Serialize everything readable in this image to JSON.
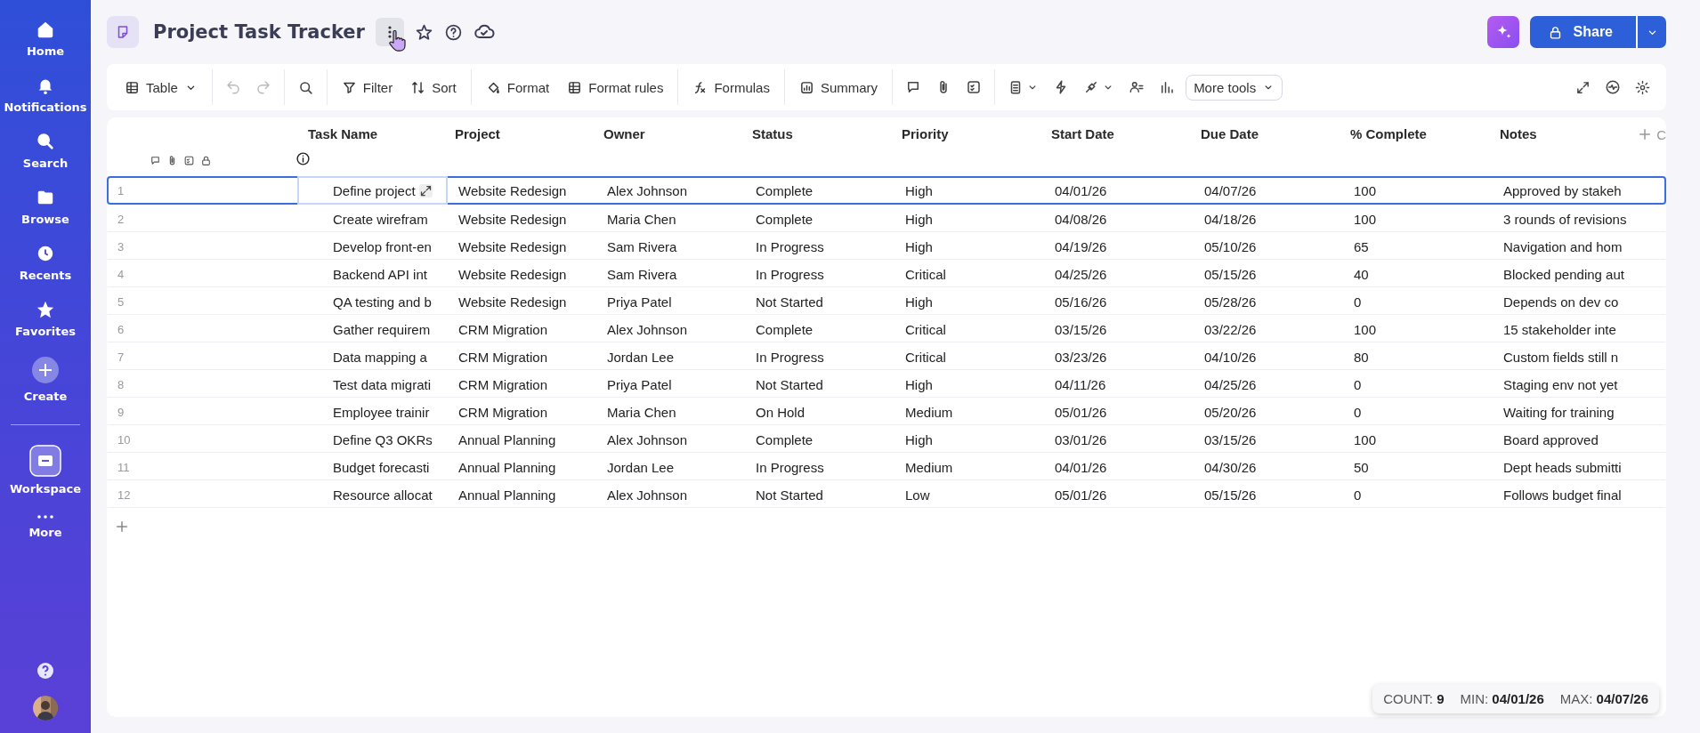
{
  "sidebar": {
    "items": [
      {
        "label": "Home"
      },
      {
        "label": "Notifications"
      },
      {
        "label": "Search"
      },
      {
        "label": "Browse"
      },
      {
        "label": "Recents"
      },
      {
        "label": "Favorites"
      },
      {
        "label": "Create"
      },
      {
        "label": "Workspace"
      },
      {
        "label": "More"
      }
    ]
  },
  "header": {
    "title": "Project Task Tracker",
    "share": "Share"
  },
  "toolbar": {
    "view": "Table",
    "buttons": [
      "Filter",
      "Sort",
      "Format",
      "Format rules",
      "Formulas",
      "Summary"
    ],
    "more": "More tools"
  },
  "table": {
    "columns": [
      "Task Name",
      "Project",
      "Owner",
      "Status",
      "Priority",
      "Start Date",
      "Due Date",
      "% Complete",
      "Notes"
    ],
    "add_column": "C",
    "rows": [
      {
        "number": "1",
        "selected": true,
        "cells": [
          "Define project",
          "Website Redesign",
          "Alex Johnson",
          "Complete",
          "High",
          "04/01/26",
          "04/07/26",
          "100",
          "Approved by stakeh"
        ]
      },
      {
        "number": "2",
        "selected": false,
        "cells": [
          "Create wirefram",
          "Website Redesign",
          "Maria Chen",
          "Complete",
          "High",
          "04/08/26",
          "04/18/26",
          "100",
          "3 rounds of revisions"
        ]
      },
      {
        "number": "3",
        "selected": false,
        "cells": [
          "Develop front-en",
          "Website Redesign",
          "Sam Rivera",
          "In Progress",
          "High",
          "04/19/26",
          "05/10/26",
          "65",
          "Navigation and hom"
        ]
      },
      {
        "number": "4",
        "selected": false,
        "cells": [
          "Backend API int",
          "Website Redesign",
          "Sam Rivera",
          "In Progress",
          "Critical",
          "04/25/26",
          "05/15/26",
          "40",
          "Blocked pending aut"
        ]
      },
      {
        "number": "5",
        "selected": false,
        "cells": [
          "QA testing and b",
          "Website Redesign",
          "Priya Patel",
          "Not Started",
          "High",
          "05/16/26",
          "05/28/26",
          "0",
          "Depends on dev co"
        ]
      },
      {
        "number": "6",
        "selected": false,
        "cells": [
          "Gather requirem",
          "CRM Migration",
          "Alex Johnson",
          "Complete",
          "Critical",
          "03/15/26",
          "03/22/26",
          "100",
          "15 stakeholder inte"
        ]
      },
      {
        "number": "7",
        "selected": false,
        "cells": [
          "Data mapping a",
          "CRM Migration",
          "Jordan Lee",
          "In Progress",
          "Critical",
          "03/23/26",
          "04/10/26",
          "80",
          "Custom fields still n"
        ]
      },
      {
        "number": "8",
        "selected": false,
        "cells": [
          "Test data migrati",
          "CRM Migration",
          "Priya Patel",
          "Not Started",
          "High",
          "04/11/26",
          "04/25/26",
          "0",
          "Staging env not yet"
        ]
      },
      {
        "number": "9",
        "selected": false,
        "cells": [
          "Employee trainir",
          "CRM Migration",
          "Maria Chen",
          "On Hold",
          "Medium",
          "05/01/26",
          "05/20/26",
          "0",
          "Waiting for training"
        ]
      },
      {
        "number": "10",
        "selected": false,
        "cells": [
          "Define Q3 OKRs",
          "Annual Planning",
          "Alex Johnson",
          "Complete",
          "High",
          "03/01/26",
          "03/15/26",
          "100",
          "Board approved"
        ]
      },
      {
        "number": "11",
        "selected": false,
        "cells": [
          "Budget forecasti",
          "Annual Planning",
          "Jordan Lee",
          "In Progress",
          "Medium",
          "04/01/26",
          "04/30/26",
          "50",
          "Dept heads submitti"
        ]
      },
      {
        "number": "12",
        "selected": false,
        "cells": [
          "Resource allocat",
          "Annual Planning",
          "Alex Johnson",
          "Not Started",
          "Low",
          "05/01/26",
          "05/15/26",
          "0",
          "Follows budget final"
        ]
      }
    ]
  },
  "summary": [
    {
      "label": "COUNT:",
      "value": "9"
    },
    {
      "label": "MIN:",
      "value": "04/01/26"
    },
    {
      "label": "MAX:",
      "value": "04/07/26"
    }
  ]
}
